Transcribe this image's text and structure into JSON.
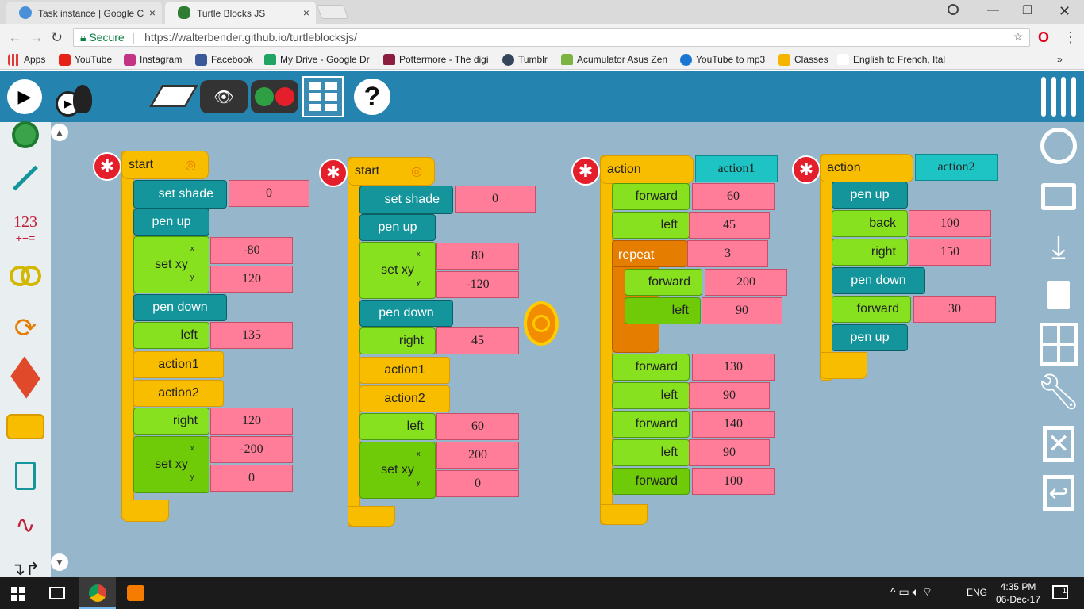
{
  "browser": {
    "tabs": [
      {
        "title": "Task instance | Google C",
        "close": "×"
      },
      {
        "title": "Turtle Blocks JS",
        "close": "×"
      }
    ],
    "secure_label": "Secure",
    "url": "https://walterbender.github.io/turtleblocksjs/",
    "bookmarks": [
      "Apps",
      "YouTube",
      "Instagram",
      "Facebook",
      "My Drive - Google Dr",
      "Pottermore - The digi",
      "Tumblr",
      "Acumulator Asus Zen",
      "YouTube to mp3",
      "Classes",
      "English to French, Ital"
    ],
    "more_bookmarks": "»"
  },
  "palette": {
    "items": [
      "turtle",
      "pen",
      "number",
      "boolean",
      "flow",
      "box",
      "action",
      "media",
      "sensors",
      "extras"
    ],
    "number_label": "123"
  },
  "stacks": {
    "start1": {
      "label": "start",
      "set_shade": "set shade",
      "shade_val": "0",
      "pen_up": "pen up",
      "set_xy": "set xy",
      "x": "x",
      "y": "y",
      "x_val": "-80",
      "y_val": "120",
      "pen_down": "pen down",
      "left": "left",
      "left_val": "135",
      "action1": "action1",
      "action2": "action2",
      "right": "right",
      "right_val": "120",
      "set_xy2": "set xy",
      "x2_val": "-200",
      "y2_val": "0"
    },
    "start2": {
      "label": "start",
      "set_shade": "set shade",
      "shade_val": "0",
      "pen_up": "pen up",
      "set_xy": "set xy",
      "x": "x",
      "y": "y",
      "x_val": "80",
      "y_val": "-120",
      "pen_down": "pen down",
      "right": "right",
      "right_val": "45",
      "action1": "action1",
      "action2": "action2",
      "left": "left",
      "left_val": "60",
      "set_xy2": "set xy",
      "x2_val": "200",
      "y2_val": "0"
    },
    "action1": {
      "label": "action",
      "name": "action1",
      "forward": "forward",
      "f1": "60",
      "left": "left",
      "l1": "45",
      "repeat": "repeat",
      "rep_val": "3",
      "rf": "200",
      "rl": "90",
      "f2": "130",
      "l2": "90",
      "f3": "140",
      "l3": "90",
      "f4": "100"
    },
    "action2": {
      "label": "action",
      "name": "action2",
      "pen_up": "pen up",
      "back": "back",
      "back_val": "100",
      "right": "right",
      "right_val": "150",
      "pen_down": "pen down",
      "forward": "forward",
      "forward_val": "30",
      "pen_up2": "pen up"
    }
  },
  "taskbar": {
    "time": "4:35 PM",
    "date": "06-Dec-17",
    "lang": "ENG",
    "notif": "1"
  },
  "colors": {
    "toolbar": "#2584af",
    "canvas": "#96b7cb",
    "hat": "#f9bd00",
    "teal": "#13959b",
    "green": "#88e11f",
    "pink": "#ff7d99",
    "cyan": "#1ec3c3"
  }
}
